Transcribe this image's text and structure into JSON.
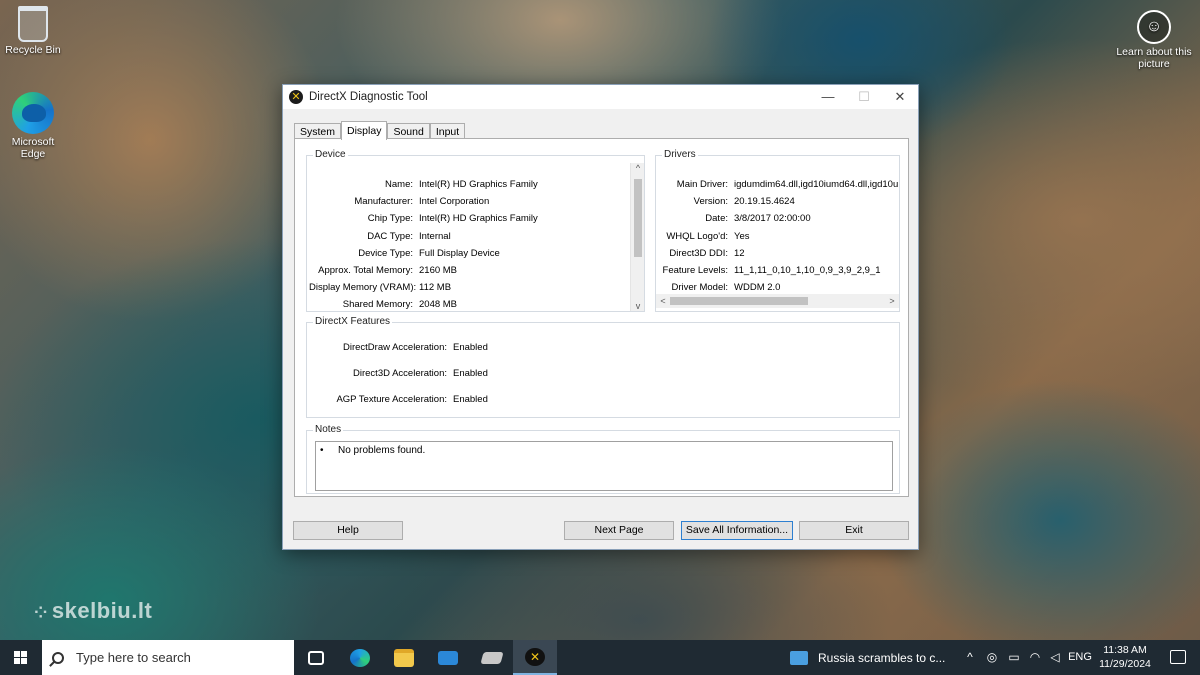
{
  "desktop": {
    "recycle_bin": "Recycle Bin",
    "edge": "Microsoft Edge",
    "learn": "Learn about this picture",
    "watermark": "skelbiu.lt"
  },
  "window": {
    "title": "DirectX Diagnostic Tool",
    "tabs": [
      {
        "label": "System"
      },
      {
        "label": "Display"
      },
      {
        "label": "Sound"
      },
      {
        "label": "Input"
      }
    ],
    "active_tab": "Display",
    "device": {
      "title": "Device",
      "rows": [
        {
          "k": "Name:",
          "v": "Intel(R) HD Graphics Family"
        },
        {
          "k": "Manufacturer:",
          "v": "Intel Corporation"
        },
        {
          "k": "Chip Type:",
          "v": "Intel(R) HD Graphics Family"
        },
        {
          "k": "DAC Type:",
          "v": "Internal"
        },
        {
          "k": "Device Type:",
          "v": "Full Display Device"
        },
        {
          "k": "Approx. Total Memory:",
          "v": "2160 MB"
        },
        {
          "k": "Display Memory (VRAM):",
          "v": "112 MB"
        },
        {
          "k": "Shared Memory:",
          "v": "2048 MB"
        }
      ]
    },
    "drivers": {
      "title": "Drivers",
      "rows": [
        {
          "k": "Main Driver:",
          "v": "igdumdim64.dll,igd10iumd64.dll,igd10u"
        },
        {
          "k": "Version:",
          "v": "20.19.15.4624"
        },
        {
          "k": "Date:",
          "v": "3/8/2017 02:00:00"
        },
        {
          "k": "WHQL Logo'd:",
          "v": "Yes"
        },
        {
          "k": "Direct3D DDI:",
          "v": "12"
        },
        {
          "k": "Feature Levels:",
          "v": "11_1,11_0,10_1,10_0,9_3,9_2,9_1"
        },
        {
          "k": "Driver Model:",
          "v": "WDDM 2.0"
        }
      ]
    },
    "features": {
      "title": "DirectX Features",
      "rows": [
        {
          "k": "DirectDraw Acceleration:",
          "v": "Enabled"
        },
        {
          "k": "Direct3D Acceleration:",
          "v": "Enabled"
        },
        {
          "k": "AGP Texture Acceleration:",
          "v": "Enabled"
        }
      ]
    },
    "notes": {
      "title": "Notes",
      "bullet": "•",
      "text": "No problems found."
    },
    "buttons": {
      "help": "Help",
      "next_page": "Next Page",
      "save_all": "Save All Information...",
      "exit": "Exit"
    }
  },
  "taskbar": {
    "search_placeholder": "Type here to search",
    "news": "Russia scrambles to c...",
    "language": "ENG",
    "time": "11:38 AM",
    "date": "11/29/2024"
  }
}
